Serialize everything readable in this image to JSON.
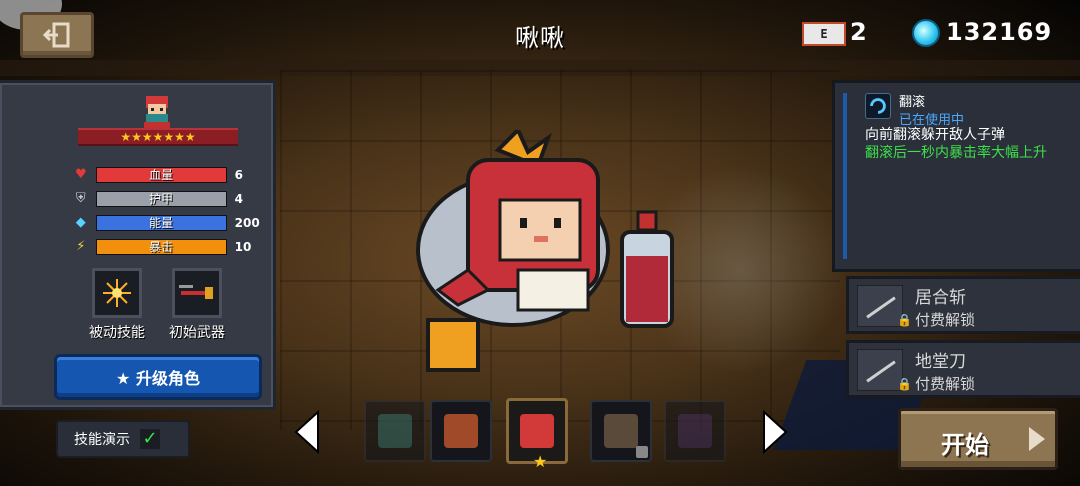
{
  "header": {
    "title": "啾啾",
    "ticket_label": "E",
    "ticket_count": "2",
    "gems": "132169"
  },
  "left_panel": {
    "stars": "★★★★★★★",
    "stats": [
      {
        "label": "血量",
        "value": "6",
        "fill": 1.0,
        "color": "#e23a3a",
        "icon": "heart-icon"
      },
      {
        "label": "护甲",
        "value": "4",
        "fill": 1.0,
        "color": "#9aa0aa",
        "icon": "shield-icon"
      },
      {
        "label": "能量",
        "value": "200",
        "fill": 1.0,
        "color": "#3a72e0",
        "icon": "energy-icon"
      },
      {
        "label": "暴击",
        "value": "10",
        "fill": 1.0,
        "color": "#f2900e",
        "icon": "crit-icon"
      }
    ],
    "passive_label": "被动技能",
    "weapon_label": "初始武器",
    "upgrade_label": "★ 升级角色"
  },
  "demo": {
    "label": "技能演示",
    "checked": "✓"
  },
  "skill": {
    "name": "翻滚",
    "status": "已在使用中",
    "desc": "向前翻滚躲开敌人子弹",
    "bonus": "翻滚后一秒内暴击率大幅上升"
  },
  "locked_skills": [
    {
      "name": "居合斩",
      "price": "付费解锁"
    },
    {
      "name": "地堂刀",
      "price": "付费解锁"
    }
  ],
  "start_label": "开始",
  "colors": {
    "accent_blue": "#1556b0",
    "gem": "#32c8f0",
    "star": "#ffc81e",
    "green_text": "#3ee04a"
  }
}
